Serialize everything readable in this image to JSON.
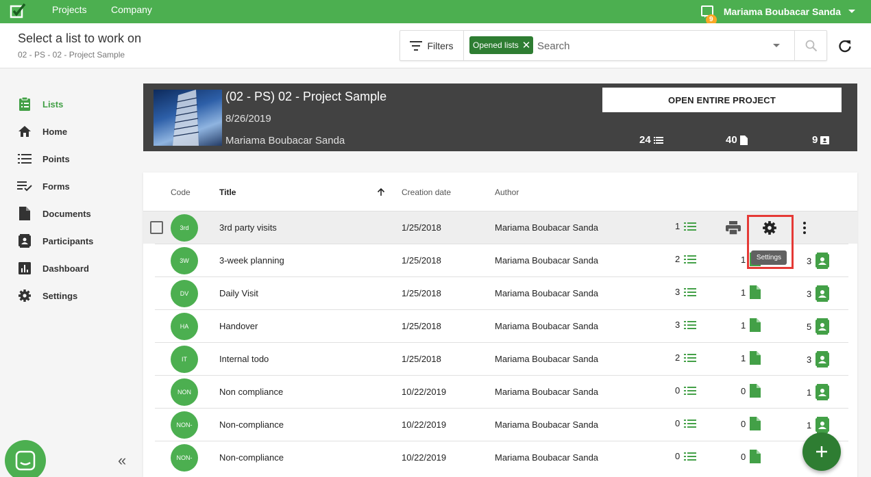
{
  "topbar": {
    "nav": [
      "Projects",
      "Company"
    ],
    "user_name": "Mariama Boubacar Sanda",
    "notification_count": "9",
    "brand_color": "#4caf50"
  },
  "header": {
    "title": "Select a list to work on",
    "breadcrumb": "02 - PS - 02 - Project Sample",
    "filters_label": "Filters",
    "chip_label": "Opened lists",
    "search_placeholder": "Search"
  },
  "sidebar": {
    "items": [
      {
        "label": "Lists",
        "icon": "clipboard-list-icon"
      },
      {
        "label": "Home",
        "icon": "home-icon"
      },
      {
        "label": "Points",
        "icon": "list-icon"
      },
      {
        "label": "Forms",
        "icon": "checklist-icon"
      },
      {
        "label": "Documents",
        "icon": "document-icon"
      },
      {
        "label": "Participants",
        "icon": "contact-card-icon"
      },
      {
        "label": "Dashboard",
        "icon": "bar-chart-icon"
      },
      {
        "label": "Settings",
        "icon": "gear-icon"
      }
    ]
  },
  "project": {
    "title": "(02 - PS) 02 - Project Sample",
    "date": "8/26/2019",
    "author": "Mariama Boubacar Sanda",
    "open_button": "OPEN ENTIRE PROJECT",
    "lists_count": "24",
    "documents_count": "40",
    "participants_count": "9"
  },
  "table": {
    "columns": {
      "code": "Code",
      "title": "Title",
      "creation_date": "Creation date",
      "author": "Author"
    },
    "tooltip": "Settings",
    "rows": [
      {
        "code": "3rd",
        "title": "3rd party visits",
        "date": "1/25/2018",
        "author": "Mariama Boubacar Sanda",
        "points": "1",
        "docs": "",
        "participants": ""
      },
      {
        "code": "3W",
        "title": "3-week planning",
        "date": "1/25/2018",
        "author": "Mariama Boubacar Sanda",
        "points": "2",
        "docs": "1",
        "participants": "3"
      },
      {
        "code": "DV",
        "title": "Daily Visit",
        "date": "1/25/2018",
        "author": "Mariama Boubacar Sanda",
        "points": "3",
        "docs": "1",
        "participants": "3"
      },
      {
        "code": "HA",
        "title": "Handover",
        "date": "1/25/2018",
        "author": "Mariama Boubacar Sanda",
        "points": "3",
        "docs": "1",
        "participants": "5"
      },
      {
        "code": "IT",
        "title": "Internal todo",
        "date": "1/25/2018",
        "author": "Mariama Boubacar Sanda",
        "points": "2",
        "docs": "1",
        "participants": "3"
      },
      {
        "code": "NON",
        "title": "Non compliance",
        "date": "10/22/2019",
        "author": "Mariama Boubacar Sanda",
        "points": "0",
        "docs": "0",
        "participants": "1"
      },
      {
        "code": "NON-",
        "title": "Non-compliance",
        "date": "10/22/2019",
        "author": "Mariama Boubacar Sanda",
        "points": "0",
        "docs": "0",
        "participants": "1"
      },
      {
        "code": "NON-",
        "title": "Non-compliance",
        "date": "10/22/2019",
        "author": "Mariama Boubacar Sanda",
        "points": "0",
        "docs": "0",
        "participants": ""
      }
    ]
  }
}
